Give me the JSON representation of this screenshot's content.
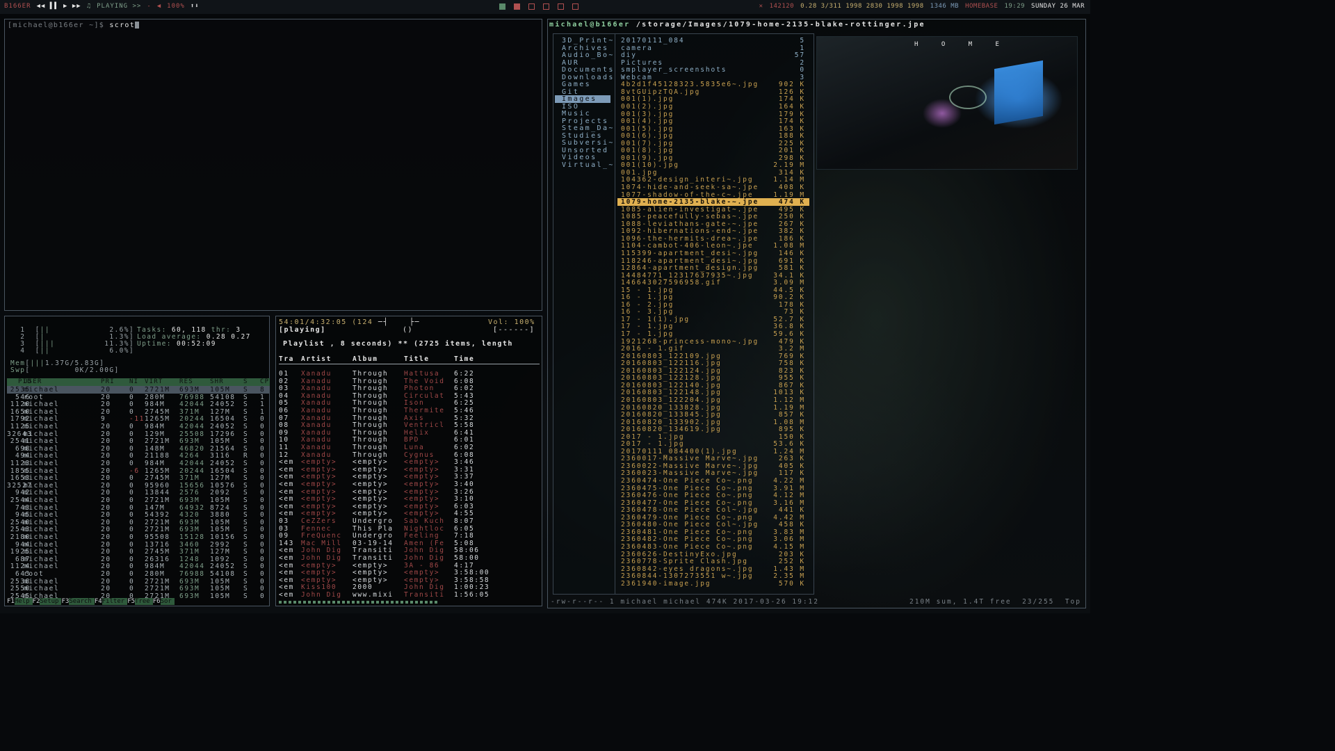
{
  "topbar": {
    "host": "B166ER",
    "media_controls": "◀◀ ▌▌ ▶ ▶▶",
    "playing": "PLAYING >>",
    "dash": "-",
    "volume": "100%",
    "updown": "⬆⬇",
    "net": "142120",
    "load": "0.28 3/311 1998 2830 1998 1998",
    "mem": "1346 MB",
    "location": "HOMEBASE",
    "time": "19:29",
    "date": "SUNDAY 26 MAR"
  },
  "terminal": {
    "prompt": "[michael@b166er ~]$ ",
    "command": "scrot"
  },
  "htop": {
    "cpus": [
      {
        "n": "1",
        "pct": "2.6%"
      },
      {
        "n": "2",
        "pct": "1.3%"
      },
      {
        "n": "3",
        "pct": "11.3%"
      },
      {
        "n": "4",
        "pct": "6.0%"
      }
    ],
    "mem": "1.37G/5.83G",
    "swp": "0K/2.00G",
    "tasks": "60, 118",
    "thr": "3",
    "load_average": "0.28 0.27",
    "uptime": "00:52:09",
    "columns": [
      "PID",
      "USER",
      "PRI",
      "NI",
      "VIRT",
      "RES",
      "SHR",
      "S",
      "CP"
    ],
    "rows": [
      [
        "2535",
        "michael",
        "20",
        "0",
        "2721M",
        "693M",
        "105M",
        "S",
        "8"
      ],
      [
        "546",
        "root",
        "20",
        "0",
        "280M",
        "76988",
        "54108",
        "S",
        "1"
      ],
      [
        "1120",
        "michael",
        "20",
        "0",
        "984M",
        "42044",
        "24052",
        "S",
        "1"
      ],
      [
        "1650",
        "michael",
        "20",
        "0",
        "2745M",
        "371M",
        "127M",
        "S",
        "1"
      ],
      [
        "1792",
        "michael",
        "9",
        "-11",
        "1265M",
        "20244",
        "16504",
        "S",
        "0"
      ],
      [
        "1125",
        "michael",
        "20",
        "0",
        "984M",
        "42044",
        "24052",
        "S",
        "0"
      ],
      [
        "32643",
        "michael",
        "20",
        "0",
        "129M",
        "25508",
        "17296",
        "S",
        "0"
      ],
      [
        "2541",
        "michael",
        "20",
        "0",
        "2721M",
        "693M",
        "105M",
        "S",
        "0"
      ],
      [
        "698",
        "michael",
        "20",
        "0",
        "148M",
        "46820",
        "21564",
        "S",
        "0"
      ],
      [
        "494",
        "michael",
        "20",
        "0",
        "21188",
        "4264",
        "3116",
        "R",
        "0"
      ],
      [
        "1123",
        "michael",
        "20",
        "0",
        "984M",
        "42044",
        "24052",
        "S",
        "0"
      ],
      [
        "1855",
        "michael",
        "20",
        "-6",
        "1265M",
        "20244",
        "16504",
        "S",
        "0"
      ],
      [
        "1653",
        "michael",
        "20",
        "0",
        "2745M",
        "371M",
        "127M",
        "S",
        "0"
      ],
      [
        "32527",
        "michael",
        "20",
        "0",
        "95960",
        "15656",
        "10576",
        "S",
        "0"
      ],
      [
        "942",
        "michael",
        "20",
        "0",
        "13844",
        "2576",
        "2092",
        "S",
        "0"
      ],
      [
        "2544",
        "michael",
        "20",
        "0",
        "2721M",
        "693M",
        "105M",
        "S",
        "0"
      ],
      [
        "743",
        "michael",
        "20",
        "0",
        "147M",
        "64932",
        "8724",
        "S",
        "0"
      ],
      [
        "945",
        "michael",
        "20",
        "0",
        "54392",
        "4320",
        "3880",
        "S",
        "0"
      ],
      [
        "2540",
        "michael",
        "20",
        "0",
        "2721M",
        "693M",
        "105M",
        "S",
        "0"
      ],
      [
        "2543",
        "michael",
        "20",
        "0",
        "2721M",
        "693M",
        "105M",
        "S",
        "0"
      ],
      [
        "2180",
        "michael",
        "20",
        "0",
        "95508",
        "15128",
        "10156",
        "S",
        "0"
      ],
      [
        "944",
        "michael",
        "20",
        "0",
        "13716",
        "3460",
        "2992",
        "S",
        "0"
      ],
      [
        "1925",
        "michael",
        "20",
        "0",
        "2745M",
        "371M",
        "127M",
        "S",
        "0"
      ],
      [
        "687",
        "michael",
        "20",
        "0",
        "26316",
        "1248",
        "1092",
        "S",
        "0"
      ],
      [
        "1124",
        "michael",
        "20",
        "0",
        "984M",
        "42044",
        "24052",
        "S",
        "0"
      ],
      [
        "643",
        "root",
        "20",
        "0",
        "280M",
        "76988",
        "54108",
        "S",
        "0"
      ],
      [
        "2538",
        "michael",
        "20",
        "0",
        "2721M",
        "693M",
        "105M",
        "S",
        "0"
      ],
      [
        "2550",
        "michael",
        "20",
        "0",
        "2721M",
        "693M",
        "105M",
        "S",
        "0"
      ],
      [
        "2545",
        "michael",
        "20",
        "0",
        "2721M",
        "693M",
        "105M",
        "S",
        "0"
      ]
    ],
    "fkeys": [
      {
        "k": "F1",
        "l": "Help"
      },
      {
        "k": "F2",
        "l": "Setup"
      },
      {
        "k": "F3",
        "l": "Search"
      },
      {
        "k": "F4",
        "l": "Filter"
      },
      {
        "k": "F5",
        "l": "Tree"
      },
      {
        "k": "F6",
        "l": "Sor"
      }
    ]
  },
  "mpc": {
    "position": "54:01/4:32:05 (124",
    "paren": "()",
    "vol": "Vol: 100%",
    "playing": "[playing]",
    "flags": "[------]",
    "playlist": "Playlist , 8 seconds) ** (2725 items, length",
    "headers": [
      "Tra",
      "Artist",
      "Album",
      "Title",
      "Time"
    ],
    "songs": [
      [
        "01",
        "Xanadu",
        "Through",
        "Hattusa",
        "6:22"
      ],
      [
        "02",
        "Xanadu",
        "Through",
        "The Void",
        "6:08"
      ],
      [
        "03",
        "Xanadu",
        "Through",
        "Photon",
        "6:02"
      ],
      [
        "04",
        "Xanadu",
        "Through",
        "Circulat",
        "5:43"
      ],
      [
        "05",
        "Xanadu",
        "Through",
        "Ison",
        "6:25"
      ],
      [
        "06",
        "Xanadu",
        "Through",
        "Thermite",
        "5:46"
      ],
      [
        "07",
        "Xanadu",
        "Through",
        "Axis",
        "5:32"
      ],
      [
        "08",
        "Xanadu",
        "Through",
        "Ventricl",
        "5:58"
      ],
      [
        "09",
        "Xanadu",
        "Through",
        "Helix",
        "6:41"
      ],
      [
        "10",
        "Xanadu",
        "Through",
        "BPD",
        "6:01"
      ],
      [
        "11",
        "Xanadu",
        "Through",
        "Luna",
        "6:02"
      ],
      [
        "12",
        "Xanadu",
        "Through",
        "Cygnus",
        "6:08"
      ],
      [
        "<em",
        "<empty>",
        "<empty>",
        "<empty>",
        "3:46"
      ],
      [
        "<em",
        "<empty>",
        "<empty>",
        "<empty>",
        "3:31"
      ],
      [
        "<em",
        "<empty>",
        "<empty>",
        "<empty>",
        "3:37"
      ],
      [
        "<em",
        "<empty>",
        "<empty>",
        "<empty>",
        "3:40"
      ],
      [
        "<em",
        "<empty>",
        "<empty>",
        "<empty>",
        "3:26"
      ],
      [
        "<em",
        "<empty>",
        "<empty>",
        "<empty>",
        "3:10"
      ],
      [
        "<em",
        "<empty>",
        "<empty>",
        "<empty>",
        "6:03"
      ],
      [
        "<em",
        "<empty>",
        "<empty>",
        "<empty>",
        "4:55"
      ],
      [
        "03",
        "CeZZers",
        "Undergro",
        "Sab Kuch",
        "8:07"
      ],
      [
        "03",
        "Fennec",
        "This Pla",
        "Nightloc",
        "6:05"
      ],
      [
        "09",
        "FreQuenc",
        "Undergro",
        "Feeling",
        "7:18"
      ],
      [
        "143",
        "Mac Mill",
        "03-19-14",
        "Amen (Fe",
        "5:08"
      ],
      [
        "<em",
        "John Dig",
        "Transiti",
        "John Dig",
        "58:06"
      ],
      [
        "<em",
        "John Dig",
        "Transiti",
        "John Dig",
        "58:00"
      ],
      [
        "<em",
        "<empty>",
        "<empty>",
        "3A - 86",
        "4:17"
      ],
      [
        "<em",
        "<empty>",
        "<empty>",
        "<empty>",
        "3:58:00"
      ],
      [
        "<em",
        "<empty>",
        "<empty>",
        "<empty>",
        "3:58:58"
      ],
      [
        "<em",
        "Kiss100",
        "2000",
        "John Dig",
        "1:00:23"
      ],
      [
        "<em",
        "John Dig",
        "www.mixi",
        "Transiti",
        "1:56:05"
      ]
    ]
  },
  "ranger": {
    "host": "michael@b166er",
    "path": "/storage/Images/1079-home-2135-blake-rottinger.jpe",
    "dirs": [
      "3D_Print~",
      "Archives",
      "Audio_Bo~",
      "AUR",
      "Documents",
      "Downloads",
      "Games",
      "Git",
      "Images",
      "ISO",
      "Music",
      "Projects",
      "Steam_Da~",
      "Studies",
      "Subversi~",
      "Unsorted",
      "Videos",
      "Virtual_~"
    ],
    "selected_dir": "Images",
    "files": [
      [
        "20170111_084",
        "5",
        "d"
      ],
      [
        "camera",
        "1",
        "d"
      ],
      [
        "diy",
        "57",
        "d"
      ],
      [
        "Pictures",
        "2",
        "d"
      ],
      [
        "smplayer_screenshots",
        "0",
        "d"
      ],
      [
        "Webcam",
        "3",
        "d"
      ],
      [
        "4b2d1f45128323.5835e6~.jpg",
        "902 K",
        "f"
      ],
      [
        "8vtGUipzTQA.jpg",
        "126 K",
        "f"
      ],
      [
        "001(1).jpg",
        "174 K",
        "f"
      ],
      [
        "001(2).jpg",
        "164 K",
        "f"
      ],
      [
        "001(3).jpg",
        "179 K",
        "f"
      ],
      [
        "001(4).jpg",
        "174 K",
        "f"
      ],
      [
        "001(5).jpg",
        "163 K",
        "f"
      ],
      [
        "001(6).jpg",
        "188 K",
        "f"
      ],
      [
        "001(7).jpg",
        "225 K",
        "f"
      ],
      [
        "001(8).jpg",
        "201 K",
        "f"
      ],
      [
        "001(9).jpg",
        "298 K",
        "f"
      ],
      [
        "001(10).jpg",
        "2.19 M",
        "f"
      ],
      [
        "001.jpg",
        "314 K",
        "f"
      ],
      [
        "104362-design_interi~.jpg",
        "1.14 M",
        "f"
      ],
      [
        "1074-hide-and-seek-sa~.jpe",
        "408 K",
        "f"
      ],
      [
        "1077-shadow-of-the-c~.jpe",
        "1.19 M",
        "f"
      ],
      [
        "1079-home-2135-blake-~.jpe",
        "474 K",
        "sel"
      ],
      [
        "1085-alien-investigat~.jpe",
        "495 K",
        "f"
      ],
      [
        "1085-peacefully-sebas~.jpe",
        "250 K",
        "f"
      ],
      [
        "1088-leviathans-gate-~.jpe",
        "267 K",
        "f"
      ],
      [
        "1092-hibernations-end~.jpe",
        "382 K",
        "f"
      ],
      [
        "1096-the-hermits-drea~.jpe",
        "186 K",
        "f"
      ],
      [
        "1104-cambot-406-leon~.jpe",
        "1.08 M",
        "f"
      ],
      [
        "115399-apartment_desi~.jpg",
        "146 K",
        "f"
      ],
      [
        "118246-apartment_desi~.jpg",
        "691 K",
        "f"
      ],
      [
        "12864-apartment_design.jpg",
        "581 K",
        "f"
      ],
      [
        "14484771_12317637935~.jpg",
        "34.1 K",
        "f"
      ],
      [
        "146643027596958.gif",
        "3.09 M",
        "f"
      ],
      [
        "15 - 1.jpg",
        "44.5 K",
        "f"
      ],
      [
        "16 - 1.jpg",
        "90.2 K",
        "f"
      ],
      [
        "16 - 2.jpg",
        "178 K",
        "f"
      ],
      [
        "16 - 3.jpg",
        "73 K",
        "f"
      ],
      [
        "17 - 1(1).jpg",
        "52.7 K",
        "f"
      ],
      [
        "17 - 1.jpg",
        "36.8 K",
        "f"
      ],
      [
        "17 - 1.jpg",
        "59.6 K",
        "f"
      ],
      [
        "1921268-princess-mono~.jpg",
        "479 K",
        "f"
      ],
      [
        "2016 - 1.gif",
        "3.2 M",
        "f"
      ],
      [
        "20160803_122109.jpg",
        "769 K",
        "f"
      ],
      [
        "20160803_122116.jpg",
        "758 K",
        "f"
      ],
      [
        "20160803_122124.jpg",
        "823 K",
        "f"
      ],
      [
        "20160803_122128.jpg",
        "955 K",
        "f"
      ],
      [
        "20160803_122140.jpg",
        "867 K",
        "f"
      ],
      [
        "20160803_122148.jpg",
        "1013 K",
        "f"
      ],
      [
        "20160803_122204.jpg",
        "1.12 M",
        "f"
      ],
      [
        "20160820_133828.jpg",
        "1.19 M",
        "f"
      ],
      [
        "20160820_133845.jpg",
        "857 K",
        "f"
      ],
      [
        "20160820_133902.jpg",
        "1.08 M",
        "f"
      ],
      [
        "20160820_134619.jpg",
        "895 K",
        "f"
      ],
      [
        "2017 - 1.jpg",
        "150 K",
        "f"
      ],
      [
        "2017 - 1.jpg",
        "53.6 K",
        "f"
      ],
      [
        "20170111_084400(1).jpg",
        "1.24 M",
        "f"
      ],
      [
        "2360017-Massive Marve~.jpg",
        "263 K",
        "f"
      ],
      [
        "2360022-Massive Marve~.jpg",
        "405 K",
        "f"
      ],
      [
        "2360023-Massive Marve~.jpg",
        "117 K",
        "f"
      ],
      [
        "2360474-One Piece Co~.png",
        "4.22 M",
        "f"
      ],
      [
        "2360475-One Piece Co~.png",
        "3.91 M",
        "f"
      ],
      [
        "2360476-One Piece Co~.png",
        "4.12 M",
        "f"
      ],
      [
        "2360477-One Piece Co~.png",
        "3.16 M",
        "f"
      ],
      [
        "2360478-One Piece Col~.jpg",
        "441 K",
        "f"
      ],
      [
        "2360479-One Piece Co~.png",
        "4.42 M",
        "f"
      ],
      [
        "2360480-One Piece Col~.jpg",
        "458 K",
        "f"
      ],
      [
        "2360481-One Piece Co~.png",
        "3.83 M",
        "f"
      ],
      [
        "2360482-One Piece Co~.png",
        "3.06 M",
        "f"
      ],
      [
        "2360483-One Piece Co~.png",
        "4.15 M",
        "f"
      ],
      [
        "2360626-DestinyExo.jpg",
        "203 K",
        "f"
      ],
      [
        "2360778-Sprite Clash.jpg",
        "252 K",
        "f"
      ],
      [
        "2360842-eyes dragons~.jpg",
        "1.43 M",
        "f"
      ],
      [
        "2360844-1307273551 w~.jpg",
        "2.35 M",
        "f"
      ],
      [
        "2361940-image.jpg",
        "570 K",
        "f"
      ]
    ],
    "preview_logo": "H O M E",
    "status_left": "-rw-r--r-- 1 michael michael 474K 2017-03-26 19:12",
    "status_right": "210M sum, 1.4T free  23/255  Top"
  }
}
